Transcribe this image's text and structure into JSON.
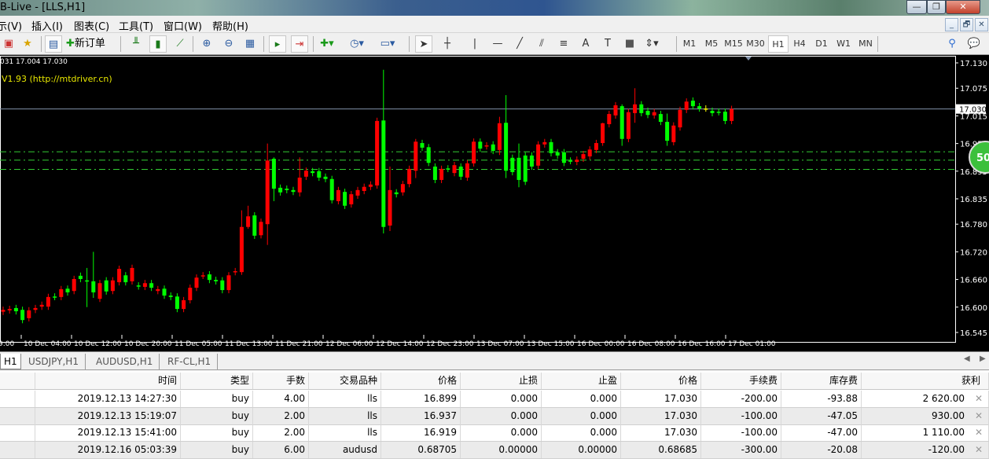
{
  "window": {
    "title": "B-Live - [LLS,H1]",
    "buttons": [
      "—",
      "❐",
      "✕"
    ]
  },
  "menu": {
    "items": [
      "示(V)",
      "插入(I)",
      "图表(C)",
      "工具(T)",
      "窗口(W)",
      "帮助(H)"
    ],
    "mdi_buttons": [
      "_",
      "🗗",
      "✕"
    ]
  },
  "toolbar": {
    "new_order_label": "新订单",
    "timeframes": [
      "M1",
      "M5",
      "M15",
      "M30",
      "H1",
      "H4",
      "D1",
      "W1",
      "MN"
    ],
    "active_timeframe": "H1"
  },
  "chart": {
    "ohlc_text": "031 17.004 17.030",
    "indicator_text": "V1.93 (http://mtdriver.cn)",
    "badge_text": "50",
    "colors": {
      "up": "#ff0000",
      "down": "#00ff00",
      "background": "#000000",
      "price_line": "#8090a8",
      "order_lines": "#33cc33",
      "doji": "#ffff00"
    },
    "chart_data": {
      "type": "candlestick",
      "symbol": "LLS",
      "timeframe": "H1",
      "ylim": [
        16.545,
        17.13
      ],
      "price_ticks": [
        "17.130",
        "17.075",
        "17.015",
        "16.955",
        "16.895",
        "16.835",
        "16.780",
        "16.720",
        "16.660",
        "16.600",
        "16.545"
      ],
      "current_price": "17.030",
      "order_levels": [
        16.937,
        16.919,
        16.899
      ],
      "time_labels": [
        "9:00",
        "10 Dec 04:00",
        "10 Dec 12:00",
        "10 Dec 20:00",
        "11 Dec 05:00",
        "11 Dec 13:00",
        "11 Dec 21:00",
        "12 Dec 06:00",
        "12 Dec 14:00",
        "12 Dec 23:00",
        "13 Dec 07:00",
        "13 Dec 15:00",
        "16 Dec 00:00",
        "16 Dec 08:00",
        "16 Dec 16:00",
        "17 Dec 01:00"
      ],
      "candles_open_close": [
        [
          16.59,
          16.594
        ],
        [
          16.593,
          16.596
        ],
        [
          16.598,
          16.591
        ],
        [
          16.594,
          16.572
        ],
        [
          16.576,
          16.593
        ],
        [
          16.594,
          16.598
        ],
        [
          16.601,
          16.605
        ],
        [
          16.601,
          16.622
        ],
        [
          16.623,
          16.622
        ],
        [
          16.622,
          16.639
        ],
        [
          16.64,
          16.632
        ],
        [
          16.635,
          16.661
        ],
        [
          16.668,
          16.661
        ],
        [
          16.658,
          16.656
        ],
        [
          16.656,
          16.632
        ],
        [
          16.618,
          16.652
        ],
        [
          16.658,
          16.634
        ],
        [
          16.635,
          16.658
        ],
        [
          16.654,
          16.683
        ],
        [
          16.669,
          16.654
        ],
        [
          16.656,
          16.685
        ],
        [
          16.647,
          16.645
        ],
        [
          16.644,
          16.652
        ],
        [
          16.652,
          16.642
        ],
        [
          16.635,
          16.639
        ],
        [
          16.64,
          16.625
        ],
        [
          16.625,
          16.622
        ],
        [
          16.623,
          16.596
        ],
        [
          16.596,
          16.615
        ],
        [
          16.615,
          16.642
        ],
        [
          16.642,
          16.664
        ],
        [
          16.668,
          16.669
        ],
        [
          16.671,
          16.659
        ],
        [
          16.659,
          16.656
        ],
        [
          16.658,
          16.637
        ],
        [
          16.637,
          16.669
        ],
        [
          16.676,
          16.678
        ],
        [
          16.676,
          16.774
        ],
        [
          16.774,
          16.797
        ],
        [
          16.799,
          16.755
        ],
        [
          16.756,
          16.785
        ],
        [
          16.78,
          16.918
        ],
        [
          16.922,
          16.857
        ],
        [
          16.859,
          16.849
        ],
        [
          16.857,
          16.854
        ],
        [
          16.854,
          16.85
        ],
        [
          16.849,
          16.881
        ],
        [
          16.883,
          16.896
        ],
        [
          16.895,
          16.891
        ],
        [
          16.895,
          16.881
        ],
        [
          16.883,
          16.878
        ],
        [
          16.878,
          16.832
        ],
        [
          16.83,
          16.854
        ],
        [
          16.85,
          16.82
        ],
        [
          16.823,
          16.845
        ],
        [
          16.842,
          16.854
        ],
        [
          16.852,
          16.861
        ],
        [
          16.861,
          16.866
        ],
        [
          16.864,
          17.004
        ],
        [
          17.005,
          16.774
        ],
        [
          16.777,
          16.854
        ],
        [
          16.849,
          16.845
        ],
        [
          16.849,
          16.867
        ],
        [
          16.867,
          16.9
        ],
        [
          16.896,
          16.959
        ],
        [
          16.956,
          16.946
        ],
        [
          16.947,
          16.913
        ],
        [
          16.905,
          16.876
        ],
        [
          16.876,
          16.9
        ],
        [
          16.901,
          16.9
        ],
        [
          16.891,
          16.908
        ],
        [
          16.905,
          16.883
        ],
        [
          16.881,
          16.912
        ],
        [
          16.912,
          16.959
        ],
        [
          16.959,
          16.944
        ],
        [
          16.949,
          16.951
        ],
        [
          16.953,
          16.939
        ],
        [
          16.941,
          16.999
        ],
        [
          17.0,
          16.896
        ],
        [
          16.924,
          16.893
        ],
        [
          16.924,
          16.876
        ],
        [
          16.929,
          16.872
        ],
        [
          16.929,
          16.905
        ],
        [
          16.907,
          16.953
        ],
        [
          16.953,
          16.958
        ],
        [
          16.958,
          16.934
        ],
        [
          16.936,
          16.929
        ],
        [
          16.936,
          16.913
        ],
        [
          16.918,
          16.917
        ],
        [
          16.915,
          16.92
        ],
        [
          16.922,
          16.932
        ],
        [
          16.927,
          16.942
        ],
        [
          16.941,
          16.956
        ],
        [
          16.956,
          16.999
        ],
        [
          16.997,
          17.019
        ],
        [
          17.016,
          17.038
        ],
        [
          17.036,
          16.965
        ],
        [
          16.965,
          17.023
        ],
        [
          17.021,
          17.04
        ],
        [
          17.04,
          17.021
        ],
        [
          17.026,
          17.017
        ],
        [
          17.016,
          17.023
        ],
        [
          17.019,
          17.002
        ],
        [
          17.002,
          16.961
        ],
        [
          16.958,
          16.994
        ],
        [
          16.99,
          17.028
        ],
        [
          17.028,
          17.046
        ],
        [
          17.048,
          17.036
        ],
        [
          17.036,
          17.031
        ],
        [
          17.031,
          17.031
        ],
        [
          17.026,
          17.021
        ],
        [
          17.024,
          17.023
        ],
        [
          17.024,
          17.004
        ],
        [
          17.004,
          17.03
        ]
      ],
      "notable_wicks": {
        "13": [
          16.685,
          16.6
        ],
        "14": [
          16.72,
          16.62
        ],
        "37": [
          16.81,
          16.67
        ],
        "38": [
          16.82,
          16.77
        ],
        "41": [
          16.955,
          16.735
        ],
        "42": [
          16.925,
          16.83
        ],
        "46": [
          16.925,
          16.84
        ],
        "59": [
          17.115,
          16.76
        ],
        "60": [
          16.905,
          16.765
        ],
        "64": [
          16.965,
          16.88
        ],
        "77": [
          17.013,
          16.93
        ],
        "78": [
          17.06,
          16.88
        ],
        "80": [
          16.955,
          16.86
        ],
        "93": [
          17.0,
          16.95
        ],
        "96": [
          17.04,
          16.95
        ],
        "98": [
          17.075,
          17.0
        ],
        "103": [
          17.02,
          16.95
        ]
      }
    }
  },
  "tabs": [
    "H1",
    "USDJPY,H1",
    "AUDUSD,H1",
    "RF-CL,H1"
  ],
  "trades": {
    "headers": [
      "",
      "时间",
      "类型",
      "手数",
      "交易品种",
      "价格",
      "止损",
      "止盈",
      "价格",
      "手续费",
      "库存费",
      "获利"
    ],
    "rows": [
      [
        "",
        "2019.12.13 14:27:30",
        "buy",
        "4.00",
        "lls",
        "16.899",
        "0.000",
        "0.000",
        "17.030",
        "-200.00",
        "-93.88",
        "2 620.00"
      ],
      [
        "",
        "2019.12.13 15:19:07",
        "buy",
        "2.00",
        "lls",
        "16.937",
        "0.000",
        "0.000",
        "17.030",
        "-100.00",
        "-47.05",
        "930.00"
      ],
      [
        "",
        "2019.12.13 15:41:00",
        "buy",
        "2.00",
        "lls",
        "16.919",
        "0.000",
        "0.000",
        "17.030",
        "-100.00",
        "-47.00",
        "1 110.00"
      ],
      [
        "",
        "2019.12.16 05:03:39",
        "buy",
        "6.00",
        "audusd",
        "0.68705",
        "0.00000",
        "0.00000",
        "0.68685",
        "-300.00",
        "-20.08",
        "-120.00"
      ]
    ],
    "close_glyph": "✕"
  }
}
